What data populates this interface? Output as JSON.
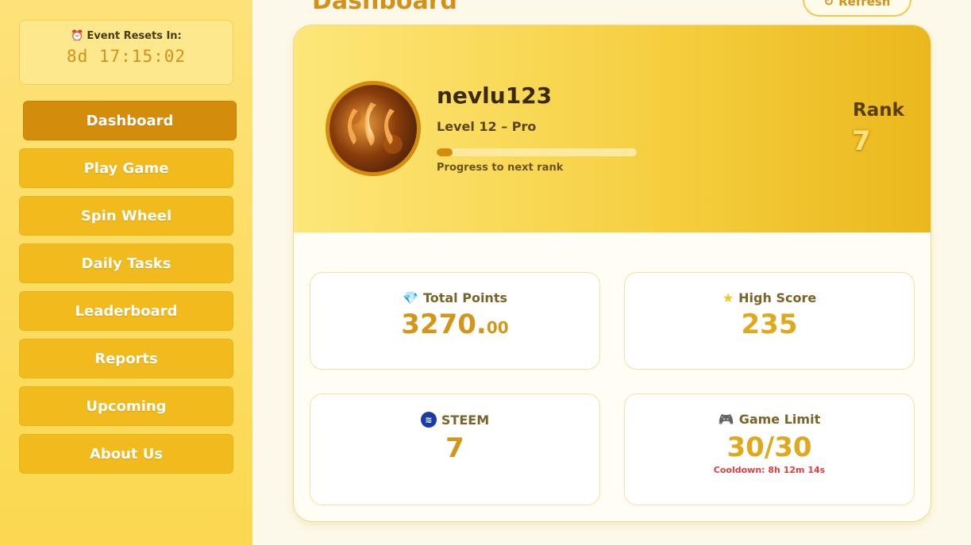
{
  "sidebar": {
    "timer_label": "Event Resets In:",
    "timer_value": "8d 17:15:02",
    "items": [
      {
        "label": "Dashboard"
      },
      {
        "label": "Play Game"
      },
      {
        "label": "Spin Wheel"
      },
      {
        "label": "Daily Tasks"
      },
      {
        "label": "Leaderboard"
      },
      {
        "label": "Reports"
      },
      {
        "label": "Upcoming"
      },
      {
        "label": "About Us"
      }
    ]
  },
  "header": {
    "title": "Dashboard",
    "refresh_label": "Refresh"
  },
  "profile": {
    "username": "nevlu123",
    "level": "Level 12 – Pro",
    "progress_fraction": 0.08,
    "progress_label": "Progress to next rank",
    "rank_label": "Rank",
    "rank_value": "7"
  },
  "stats": {
    "total_points": {
      "label": "Total Points",
      "value_int": "3270.",
      "value_dec": "00",
      "icon": "gem-icon"
    },
    "high_score": {
      "label": "High Score",
      "value": "235",
      "icon": "star-icon"
    },
    "steem": {
      "label": "STEEM",
      "value": "7",
      "icon": "steem-icon"
    },
    "game_limit": {
      "label": "Game Limit",
      "value": "30/30",
      "cooldown": "Cooldown: 8h 12m 14s",
      "icon": "gamepad-icon"
    }
  },
  "colors": {
    "accent": "#d4911a",
    "active_nav": "#d48c0c",
    "nav": "#f1bb1e",
    "cooldown": "#e23d3d"
  }
}
